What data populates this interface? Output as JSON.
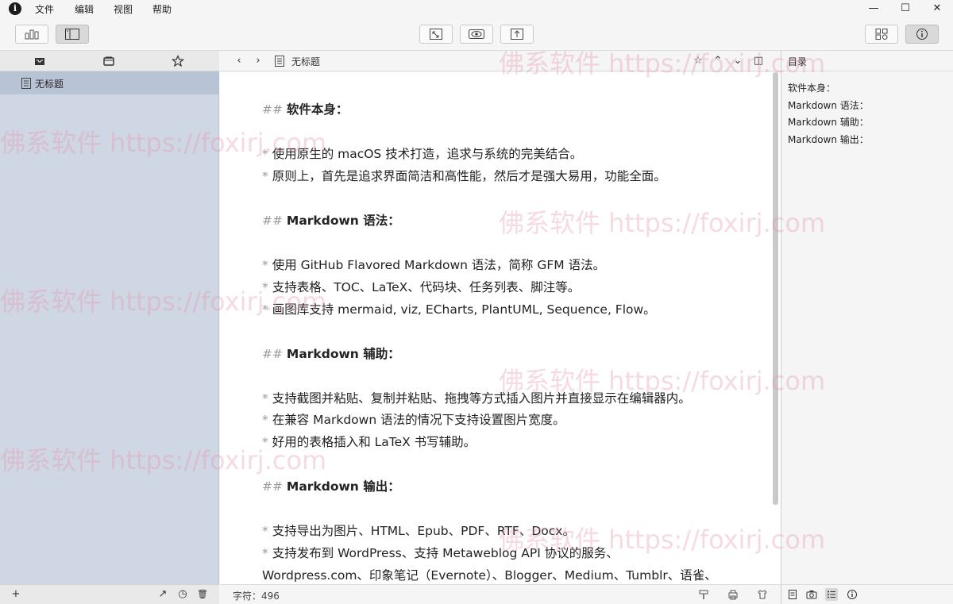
{
  "menubar": {
    "items": [
      "文件",
      "编辑",
      "视图",
      "帮助"
    ]
  },
  "window_controls": {
    "minimize": "—",
    "maximize": "☐",
    "close": "✕"
  },
  "toolbar": {
    "left_buttons": [
      "stats-icon",
      "sidebar-toggle-icon"
    ],
    "center_buttons": [
      "expand-icon",
      "preview-eye-icon",
      "export-icon"
    ],
    "right_buttons": [
      "grid-icon",
      "info-icon"
    ]
  },
  "sidebar": {
    "tabs": [
      "inbox-icon",
      "folder-icon",
      "star-icon"
    ],
    "files": [
      {
        "label": "无标题"
      }
    ],
    "bottom": {
      "add": "+",
      "chart": "↗",
      "history": "◷",
      "trash": "🗑"
    }
  },
  "editor_header": {
    "back": "‹",
    "forward": "›",
    "title": "无标题",
    "star": "☆",
    "up": "⌃",
    "down": "⌄",
    "split": "◫"
  },
  "editor": {
    "lines": [
      {
        "mark": "## ",
        "text": "软件本身：",
        "heading": true
      },
      {
        "mark": "* ",
        "text": "使用原生的 macOS 技术打造，追求与系统的完美结合。"
      },
      {
        "mark": "* ",
        "text": "原则上，首先是追求界面简洁和高性能，然后才是强大易用，功能全面。"
      },
      {
        "mark": "## ",
        "text": "Markdown 语法：",
        "heading": true
      },
      {
        "mark": "* ",
        "text": "使用 GitHub Flavored Markdown 语法，简称 GFM 语法。"
      },
      {
        "mark": "* ",
        "text": "支持表格、TOC、LaTeX、代码块、任务列表、脚注等。"
      },
      {
        "mark": "* ",
        "text": "画图库支持 mermaid, viz, ECharts, PlantUML, Sequence, Flow。"
      },
      {
        "mark": "## ",
        "text": "Markdown 辅助：",
        "heading": true
      },
      {
        "mark": "* ",
        "text": "支持截图并粘贴、复制并粘贴、拖拽等方式插入图片并直接显示在编辑器内。"
      },
      {
        "mark": "* ",
        "text": "在兼容 Markdown 语法的情况下支持设置图片宽度。"
      },
      {
        "mark": "* ",
        "text": "好用的表格插入和 LaTeX 书写辅助。"
      },
      {
        "mark": "## ",
        "text": "Markdown 输出：",
        "heading": true
      },
      {
        "mark": "* ",
        "text": "支持导出为图片、HTML、Epub、PDF、RTF、Docx。"
      },
      {
        "mark": "* ",
        "text": "支持发布到 WordPress、支持 Metaweblog API 协议的服务、"
      },
      {
        "mark": "",
        "text": "Wordpress.com、印象笔记（Evernote）、Blogger、Medium、Tumblr、语雀、"
      }
    ]
  },
  "editor_footer": {
    "word_count": "字符：496"
  },
  "toc": {
    "title": "目录",
    "items": [
      "软件本身：",
      "Markdown 语法：",
      "Markdown 辅助：",
      "Markdown 输出："
    ]
  },
  "watermark": "佛系软件 https://foxirj.com"
}
